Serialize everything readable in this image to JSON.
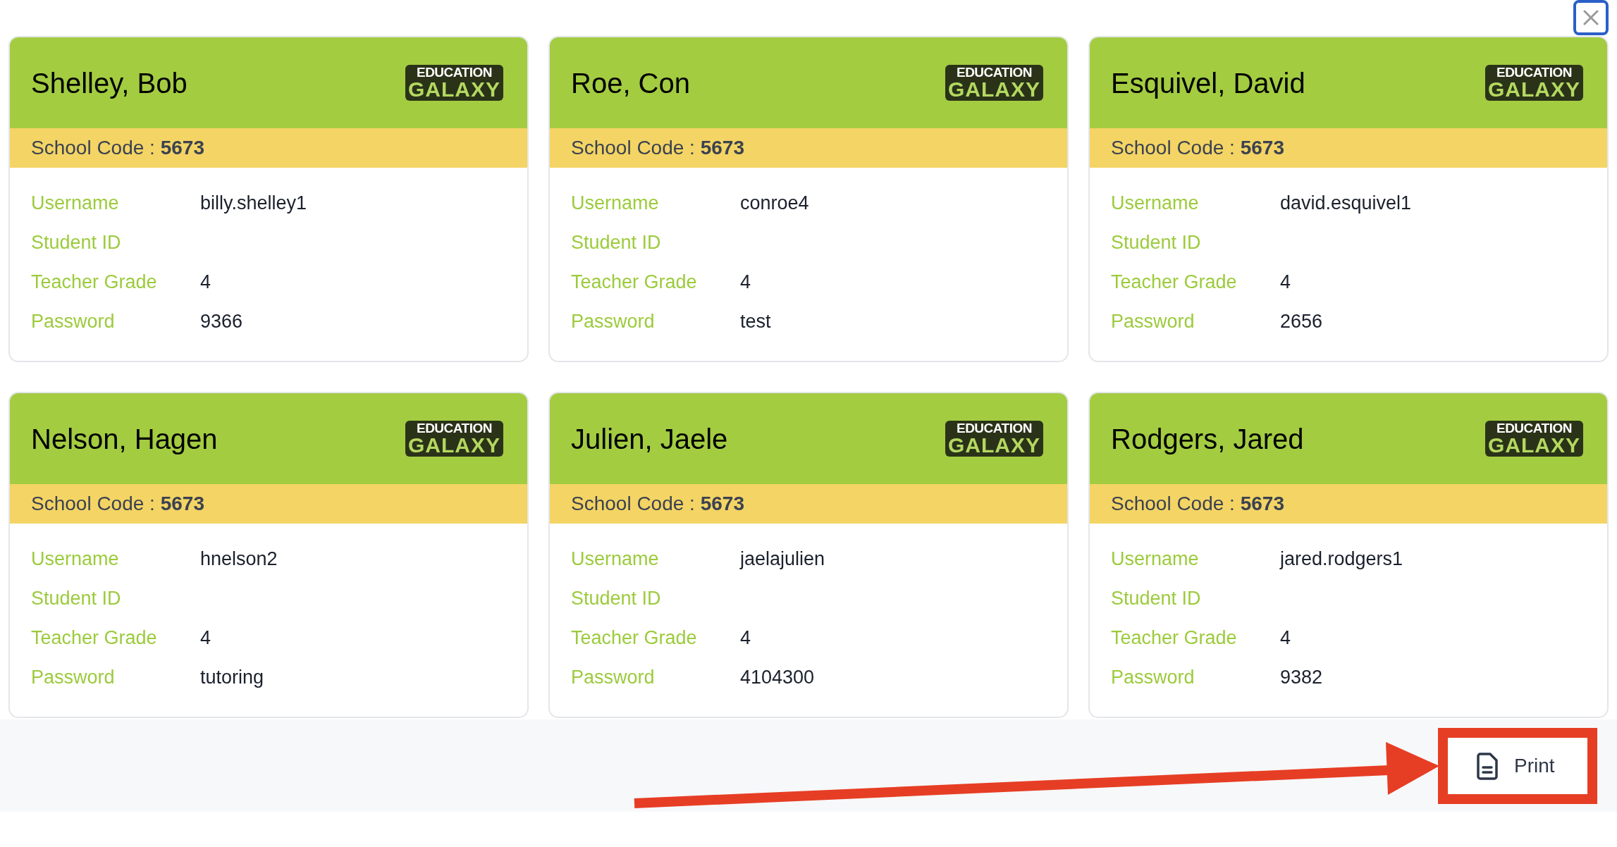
{
  "cards": [
    {
      "name": "Shelley, Bob",
      "logo": [
        "EDUCATION",
        "GALAXY"
      ],
      "school_code_label": "School Code :",
      "school_code": "5673",
      "fields": [
        {
          "label": "Username",
          "value": "billy.shelley1"
        },
        {
          "label": "Student ID"
        },
        {
          "label": "Teacher Grade",
          "value": "4"
        },
        {
          "label": "Password",
          "value": "9366"
        }
      ]
    },
    {
      "name": "Roe, Con",
      "logo": [
        "EDUCATION",
        "GALAXY"
      ],
      "school_code_label": "School Code :",
      "school_code": "5673",
      "fields": [
        {
          "label": "Username",
          "value": "conroe4"
        },
        {
          "label": "Student ID"
        },
        {
          "label": "Teacher Grade",
          "value": "4"
        },
        {
          "label": "Password",
          "value": "test"
        }
      ]
    },
    {
      "name": "Esquivel, David",
      "logo": [
        "EDUCATION",
        "GALAXY"
      ],
      "school_code_label": "School Code :",
      "school_code": "5673",
      "fields": [
        {
          "label": "Username",
          "value": "david.esquivel1"
        },
        {
          "label": "Student ID"
        },
        {
          "label": "Teacher Grade",
          "value": "4"
        },
        {
          "label": "Password",
          "value": "2656"
        }
      ]
    },
    {
      "name": "Nelson, Hagen",
      "logo": [
        "EDUCATION",
        "GALAXY"
      ],
      "school_code_label": "School Code :",
      "school_code": "5673",
      "fields": [
        {
          "label": "Username",
          "value": "hnelson2"
        },
        {
          "label": "Student ID"
        },
        {
          "label": "Teacher Grade",
          "value": "4"
        },
        {
          "label": "Password",
          "value": "tutoring"
        }
      ]
    },
    {
      "name": "Julien, Jaele",
      "logo": [
        "EDUCATION",
        "GALAXY"
      ],
      "school_code_label": "School Code :",
      "school_code": "5673",
      "fields": [
        {
          "label": "Username",
          "value": "jaelajulien"
        },
        {
          "label": "Student ID"
        },
        {
          "label": "Teacher Grade",
          "value": "4"
        },
        {
          "label": "Password",
          "value": "4104300"
        }
      ]
    },
    {
      "name": "Rodgers, Jared",
      "logo": [
        "EDUCATION",
        "GALAXY"
      ],
      "school_code_label": "School Code :",
      "school_code": "5673",
      "fields": [
        {
          "label": "Username",
          "value": "jared.rodgers1"
        },
        {
          "label": "Student ID"
        },
        {
          "label": "Teacher Grade",
          "value": "4"
        },
        {
          "label": "Password",
          "value": "9382"
        }
      ]
    }
  ],
  "footer": {
    "print_button": "Print"
  }
}
